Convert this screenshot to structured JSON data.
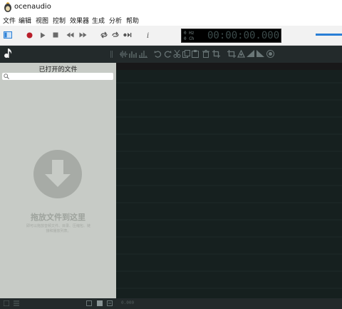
{
  "window": {
    "title": "ocenaudio"
  },
  "menu": [
    "文件",
    "编辑",
    "视图",
    "控制",
    "效果器",
    "生成",
    "分析",
    "帮助"
  ],
  "toolbar": {
    "icons": [
      "panel-toggle-icon",
      "record-icon",
      "play-icon",
      "stop-icon",
      "rewind-icon",
      "fast-forward-icon",
      "loop-icon",
      "repeat-icon",
      "skip-icon",
      "info-icon"
    ]
  },
  "time_display": {
    "hz": "0 Hz",
    "selection": "0 Ch",
    "time": "00:00:00.000"
  },
  "sidebar": {
    "title": "已打开的文件",
    "search_placeholder": "",
    "drop_title": "拖放文件到这里",
    "drop_hint": "即可以拖放音频文件、目录、压缩包、链接和播放列表。"
  },
  "status": {
    "position": "0.000"
  },
  "colors": {
    "accent": "#2a7fd6",
    "record": "#c0202a",
    "sidebar": "#c7cbc6",
    "waveform": "#16201f"
  }
}
